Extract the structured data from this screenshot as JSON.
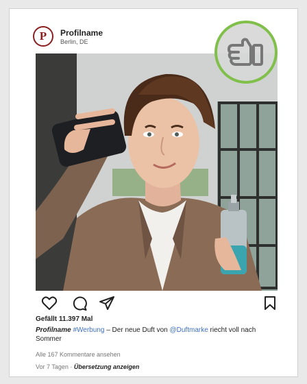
{
  "post": {
    "avatar_letter": "P",
    "profile_name": "Profilname",
    "location": "Berlin, DE",
    "likes": "Gefällt 11.397 Mal",
    "caption": {
      "user": "Profilname",
      "hashtag": "#Werbung",
      "text_before_mention": " – Der neue Duft von ",
      "mention": "@Duftmarke",
      "text_after_mention": " riecht voll nach Sommer"
    },
    "comments_link": "Alle 167 Kommentare ansehen",
    "time_ago": "Vor 7 Tagen",
    "separator": " · ",
    "translate_link": "Übersetzung anzeigen"
  },
  "icons": {
    "like": "heart-icon",
    "comment": "comment-icon",
    "share": "send-icon",
    "save": "bookmark-icon",
    "overlay": "thumbs-up-icon"
  },
  "colors": {
    "avatar_accent": "#8a1f1f",
    "link_blue": "#3f6fbf",
    "overlay_ring": "#7fbf4a"
  }
}
